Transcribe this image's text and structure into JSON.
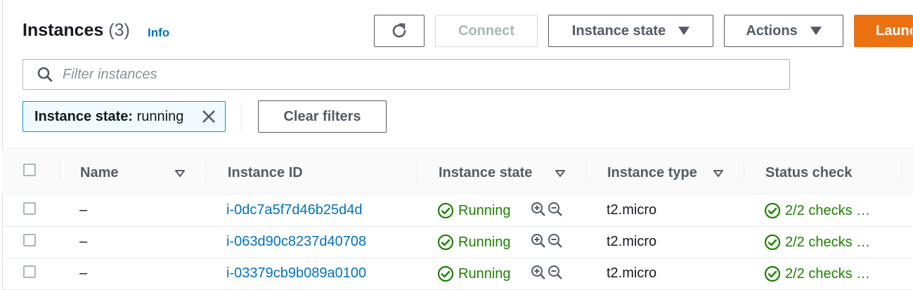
{
  "header": {
    "title": "Instances",
    "count": "(3)",
    "info_label": "Info",
    "refresh_icon": "refresh-icon",
    "connect_label": "Connect",
    "instance_state_label": "Instance state",
    "actions_label": "Actions",
    "launch_label": "Launch instances"
  },
  "search": {
    "placeholder": "Filter instances",
    "value": ""
  },
  "filter_token": {
    "key": "Instance state:",
    "value": "running"
  },
  "clear_filters_label": "Clear filters",
  "table": {
    "columns": [
      "Name",
      "Instance ID",
      "Instance state",
      "Instance type",
      "Status check"
    ],
    "rows": [
      {
        "name": "–",
        "id": "i-0dc7a5f7d46b25d4d",
        "state": "Running",
        "type": "t2.micro",
        "status": "2/2 checks …"
      },
      {
        "name": "–",
        "id": "i-063d90c8237d40708",
        "state": "Running",
        "type": "t2.micro",
        "status": "2/2 checks …"
      },
      {
        "name": "–",
        "id": "i-03379cb9b089a0100",
        "state": "Running",
        "type": "t2.micro",
        "status": "2/2 checks …"
      }
    ]
  },
  "colors": {
    "accent": "#ec7211",
    "link": "#0073bb",
    "success": "#1d8102"
  }
}
